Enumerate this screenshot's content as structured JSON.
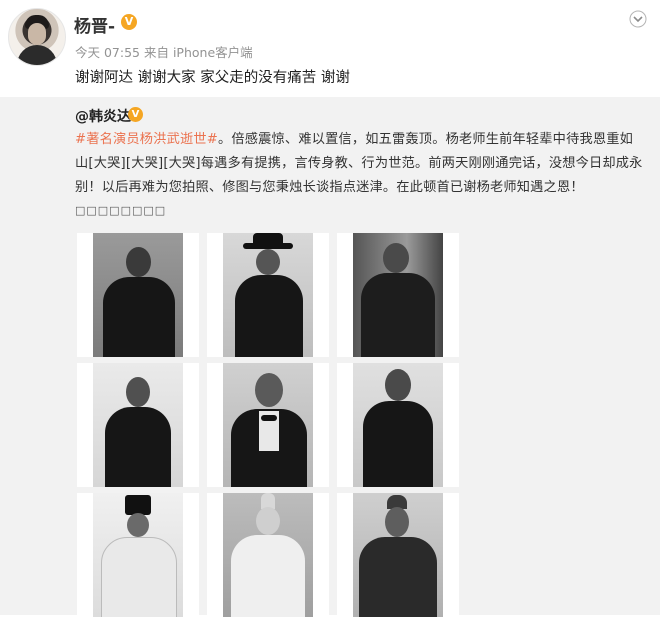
{
  "post": {
    "author": "杨晋-",
    "verified_badge": "V",
    "time": "今天 07:55",
    "source": "来自 iPhone客户端",
    "text": "谢谢阿达 谢谢大家 家父走的没有痛苦 谢谢",
    "menu_icon": "chevron-down-icon"
  },
  "repost": {
    "author": "@韩炎达",
    "verified_badge": "V",
    "hashtag": "#著名演员杨洪武逝世#",
    "line1_rest": "。倍感震惊、难以置信，如五雷轰顶。杨老师生前年轻辈中待我恩重如",
    "line2": "山[大哭][大哭][大哭]每遇多有提携，言传身教、行为世范。前两天刚刚通完话，没想今日却成永",
    "line3": "别！以后再难为您拍照、修图与您秉烛长谈指点迷津。在此顿首已谢杨老师知遇之恩！",
    "trailing_chars": "□□□□□□□□",
    "photos": [
      {
        "label": "portrait-1"
      },
      {
        "label": "portrait-2"
      },
      {
        "label": "portrait-3"
      },
      {
        "label": "portrait-4"
      },
      {
        "label": "portrait-5"
      },
      {
        "label": "portrait-6"
      },
      {
        "label": "portrait-7"
      },
      {
        "label": "portrait-8"
      },
      {
        "label": "portrait-9"
      }
    ]
  },
  "colors": {
    "hashtag": "#eb7350",
    "verified": "#f5a623",
    "repost_bg": "#f2f2f2",
    "meta_text": "#939393"
  }
}
